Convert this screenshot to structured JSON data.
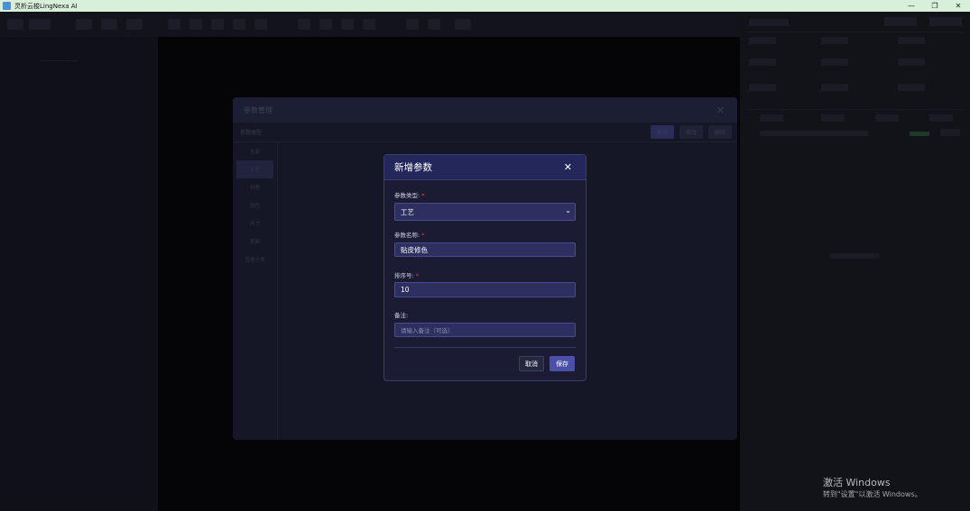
{
  "window": {
    "title": "灵析云梭LingNexa AI",
    "controls": [
      "—",
      "❐",
      "✕"
    ]
  },
  "background": {
    "left_panel_text": "——————",
    "right_panel_tab_labels": [
      "",
      "",
      "",
      ""
    ]
  },
  "param_manager": {
    "title": "参数管理",
    "close_icon": "✕",
    "sub_label": "参数类型",
    "sub_buttons": [
      "新增",
      "修改",
      "删除"
    ],
    "side_items": [
      "全部",
      "工艺",
      "材质",
      "颜色",
      "尺寸",
      "表面",
      "其他分类"
    ],
    "active_side_index": 1
  },
  "dialog": {
    "title": "新增参数",
    "close_icon": "✕",
    "fields": [
      {
        "label": "参数类型:",
        "required": "*",
        "value": "工艺",
        "type": "select"
      },
      {
        "label": "参数名称:",
        "required": "*",
        "value": "贴皮修色",
        "type": "text"
      },
      {
        "label": "排序号:",
        "required": "*",
        "value": "10",
        "type": "number"
      },
      {
        "label": "备注:",
        "required": "",
        "value": "",
        "placeholder": "请输入备注（可选）",
        "type": "text"
      }
    ],
    "cancel_label": "取消",
    "save_label": "保存"
  },
  "watermark": {
    "line1": "激活 Windows",
    "line2": "转到\"设置\"以激活 Windows。"
  },
  "colors": {
    "accent": "#4b4fa8",
    "dialog_bg": "#1b1c33",
    "field_bg": "#2d2f61",
    "required": "#e04848"
  }
}
